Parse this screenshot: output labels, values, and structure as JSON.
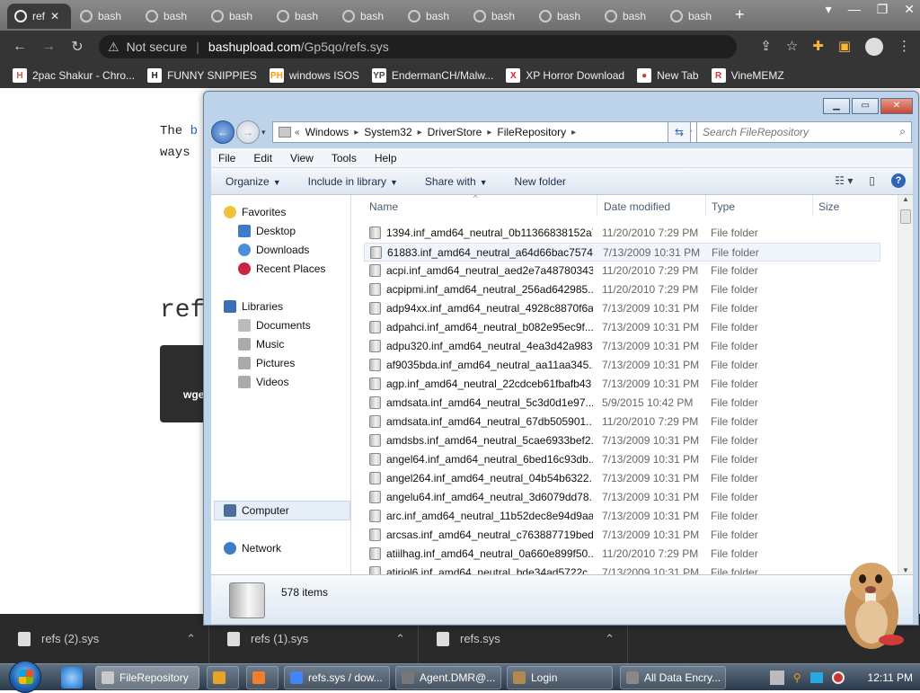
{
  "browser": {
    "tabs": [
      {
        "label": "ref",
        "active": true
      },
      {
        "label": "bash"
      },
      {
        "label": "bash"
      },
      {
        "label": "bash"
      },
      {
        "label": "bash"
      },
      {
        "label": "bash"
      },
      {
        "label": "bash"
      },
      {
        "label": "bash"
      },
      {
        "label": "bash"
      },
      {
        "label": "bash"
      },
      {
        "label": "bash"
      }
    ],
    "new_tab": "+",
    "url": {
      "security": "Not secure",
      "host": "bashupload.com",
      "path": "/Gp5qo/refs.sys"
    },
    "bookmarks": [
      {
        "label": "2pac Shakur - Chro...",
        "icon": "H",
        "color": "#d9534f"
      },
      {
        "label": "FUNNY SNIPPIES",
        "icon": "H",
        "color": "#222"
      },
      {
        "label": "windows ISOS",
        "icon": "PH",
        "color": "#f59e0b"
      },
      {
        "label": "EndermanCH/Malw...",
        "icon": "YP",
        "color": "#444"
      },
      {
        "label": "XP Horror Download",
        "icon": "X",
        "color": "#e11d2e"
      },
      {
        "label": "New Tab",
        "icon": "●",
        "color": "#b43"
      },
      {
        "label": "VineMEMZ",
        "icon": "R",
        "color": "#d9333f"
      }
    ]
  },
  "webpage": {
    "line1_prefix": "The ",
    "line1_link": "b",
    "line2": "ways",
    "heading": "ref",
    "code": "wge"
  },
  "explorer": {
    "breadcrumb": [
      "Windows",
      "System32",
      "DriverStore",
      "FileRepository"
    ],
    "search_placeholder": "Search FileRepository",
    "menu": [
      "File",
      "Edit",
      "View",
      "Tools",
      "Help"
    ],
    "commands": [
      "Organize",
      "Include in library",
      "Share with",
      "New folder"
    ],
    "columns": {
      "name": "Name",
      "date": "Date modified",
      "type": "Type",
      "size": "Size"
    },
    "nav": {
      "favorites": "Favorites",
      "fav_items": [
        "Desktop",
        "Downloads",
        "Recent Places"
      ],
      "libraries": "Libraries",
      "lib_items": [
        "Documents",
        "Music",
        "Pictures",
        "Videos"
      ],
      "computer": "Computer",
      "network": "Network"
    },
    "files": [
      {
        "name": "1394.inf_amd64_neutral_0b11366838152a76",
        "date": "11/20/2010 7:29 PM",
        "type": "File folder"
      },
      {
        "name": "61883.inf_amd64_neutral_a64d66bac7574...",
        "date": "7/13/2009 10:31 PM",
        "type": "File folder"
      },
      {
        "name": "acpi.inf_amd64_neutral_aed2e7a487803437",
        "date": "11/20/2010 7:29 PM",
        "type": "File folder"
      },
      {
        "name": "acpipmi.inf_amd64_neutral_256ad642985...",
        "date": "11/20/2010 7:29 PM",
        "type": "File folder"
      },
      {
        "name": "adp94xx.inf_amd64_neutral_4928c8870f6a...",
        "date": "7/13/2009 10:31 PM",
        "type": "File folder"
      },
      {
        "name": "adpahci.inf_amd64_neutral_b082e95ec9f...",
        "date": "7/13/2009 10:31 PM",
        "type": "File folder"
      },
      {
        "name": "adpu320.inf_amd64_neutral_4ea3d42a983...",
        "date": "7/13/2009 10:31 PM",
        "type": "File folder"
      },
      {
        "name": "af9035bda.inf_amd64_neutral_aa11aa345...",
        "date": "7/13/2009 10:31 PM",
        "type": "File folder"
      },
      {
        "name": "agp.inf_amd64_neutral_22cdceb61fbafb43",
        "date": "7/13/2009 10:31 PM",
        "type": "File folder"
      },
      {
        "name": "amdsata.inf_amd64_neutral_5c3d0d1e97...",
        "date": "5/9/2015 10:42 PM",
        "type": "File folder"
      },
      {
        "name": "amdsata.inf_amd64_neutral_67db505901...",
        "date": "11/20/2010 7:29 PM",
        "type": "File folder"
      },
      {
        "name": "amdsbs.inf_amd64_neutral_5cae6933bef2...",
        "date": "7/13/2009 10:31 PM",
        "type": "File folder"
      },
      {
        "name": "angel64.inf_amd64_neutral_6bed16c93db...",
        "date": "7/13/2009 10:31 PM",
        "type": "File folder"
      },
      {
        "name": "angel264.inf_amd64_neutral_04b54b6322...",
        "date": "7/13/2009 10:31 PM",
        "type": "File folder"
      },
      {
        "name": "angelu64.inf_amd64_neutral_3d6079dd78...",
        "date": "7/13/2009 10:31 PM",
        "type": "File folder"
      },
      {
        "name": "arc.inf_amd64_neutral_11b52dec8e94d9aa",
        "date": "7/13/2009 10:31 PM",
        "type": "File folder"
      },
      {
        "name": "arcsas.inf_amd64_neutral_c763887719bed...",
        "date": "7/13/2009 10:31 PM",
        "type": "File folder"
      },
      {
        "name": "atiilhag.inf_amd64_neutral_0a660e899f50...",
        "date": "11/20/2010 7:29 PM",
        "type": "File folder"
      },
      {
        "name": "atiriol6.inf_amd64_neutral_bde34ad5722c...",
        "date": "7/13/2009 10:31 PM",
        "type": "File folder"
      }
    ],
    "item_count": "578 items"
  },
  "downloads": [
    {
      "label": "refs (2).sys"
    },
    {
      "label": "refs (1).sys"
    },
    {
      "label": "refs.sys"
    }
  ],
  "taskbar": {
    "tasks": [
      {
        "label": "FileRepository",
        "color": "#c9c9c9",
        "active": true
      },
      {
        "label": "",
        "color": "#e8a427"
      },
      {
        "label": "",
        "color": "#f08030"
      },
      {
        "label": "refs.sys / dow...",
        "color": "#4285f4"
      },
      {
        "label": "Agent.DMR@...",
        "color": "#777"
      },
      {
        "label": "Login",
        "color": "#b08a50"
      },
      {
        "label": "All Data Encry...",
        "color": "#888"
      }
    ],
    "clock": "12:11 PM"
  }
}
